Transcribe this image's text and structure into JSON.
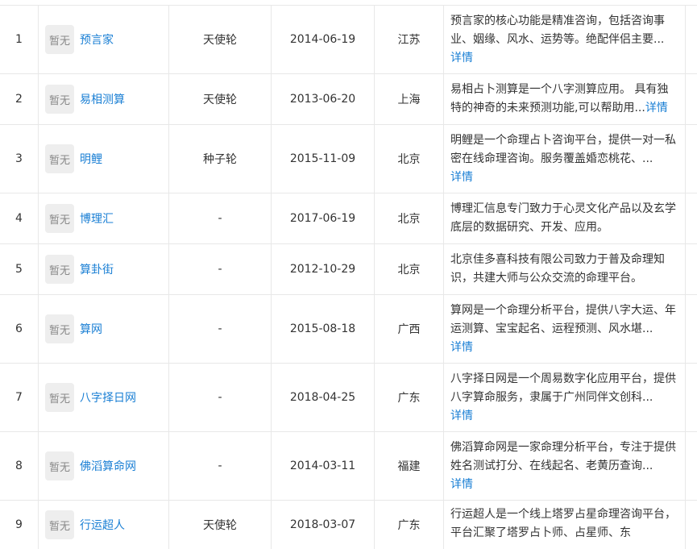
{
  "table": {
    "rows": [
      {
        "idx": "1",
        "logo": "暂无",
        "name": "预言家",
        "round": "天使轮",
        "date": "2014-06-19",
        "loc": "江苏",
        "desc": "预言家的核心功能是精准咨询，包括咨询事业、姻缘、风水、运势等。绝配伴侣主要...",
        "detail": "详情"
      },
      {
        "idx": "2",
        "logo": "暂无",
        "name": "易相测算",
        "round": "天使轮",
        "date": "2013-06-20",
        "loc": "上海",
        "desc": "易相占卜测算是一个八字测算应用。 具有独特的神奇的未来预测功能,可以帮助用...",
        "detail": "详情"
      },
      {
        "idx": "3",
        "logo": "暂无",
        "name": "明鲤",
        "round": "种子轮",
        "date": "2015-11-09",
        "loc": "北京",
        "desc": "明鲤是一个命理占卜咨询平台，提供一对一私密在线命理咨询。服务覆盖婚恋桃花、...",
        "detail": "详情"
      },
      {
        "idx": "4",
        "logo": "暂无",
        "name": "博理汇",
        "round": "-",
        "date": "2017-06-19",
        "loc": "北京",
        "desc": "博理汇信息专门致力于心灵文化产品以及玄学底层的数据研究、开发、应用。",
        "detail": ""
      },
      {
        "idx": "5",
        "logo": "暂无",
        "name": "算卦街",
        "round": "-",
        "date": "2012-10-29",
        "loc": "北京",
        "desc": "北京佳多喜科技有限公司致力于普及命理知识，共建大师与公众交流的命理平台。",
        "detail": ""
      },
      {
        "idx": "6",
        "logo": "暂无",
        "name": "算网",
        "round": "-",
        "date": "2015-08-18",
        "loc": "广西",
        "desc": "算网是一个命理分析平台，提供八字大运、年运测算、宝宝起名、运程预测、风水堪...",
        "detail": "详情"
      },
      {
        "idx": "7",
        "logo": "暂无",
        "name": "八字择日网",
        "round": "-",
        "date": "2018-04-25",
        "loc": "广东",
        "desc": "八字择日网是一个周易数字化应用平台，提供八字算命服务，隶属于广州同伴文创科...",
        "detail": "详情"
      },
      {
        "idx": "8",
        "logo": "暂无",
        "name": "佛滔算命网",
        "round": "-",
        "date": "2014-03-11",
        "loc": "福建",
        "desc": "佛滔算命网是一家命理分析平台，专注于提供姓名测试打分、在线起名、老黄历查询...",
        "detail": "详情"
      },
      {
        "idx": "9",
        "logo": "暂无",
        "name": "行运超人",
        "round": "天使轮",
        "date": "2018-03-07",
        "loc": "广东",
        "desc": "行运超人是一个线上塔罗占星命理咨询平台，平台汇聚了塔罗占卜师、占星师、东",
        "detail": ""
      }
    ]
  },
  "colors": {
    "link": "#1a7fd4",
    "border": "#e8e8e8",
    "logo_bg": "#eeeeee"
  }
}
